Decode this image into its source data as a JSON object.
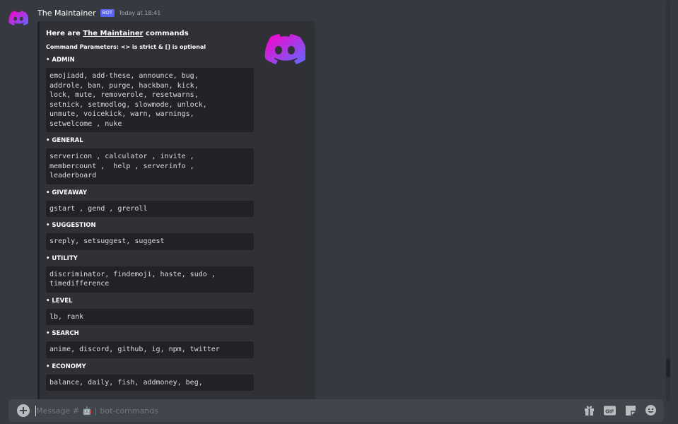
{
  "message": {
    "username": "The Maintainer",
    "bot_tag": "BOT",
    "timestamp": "Today at 18:41"
  },
  "embed": {
    "title_prefix": "Here are ",
    "title_link": "The Maintainer",
    "title_suffix": " commands",
    "description": "Command Parameters: <> is strict & [] is optional",
    "sections": [
      {
        "title": "• ADMIN",
        "commands": "emojiadd, add-these, announce, bug,\naddrole, ban, purge, hackban, kick,\nlock, mute, removerole, resetwarns,\nsetnick, setmodlog, slowmode, unlock,\nunmute, voicekick, warn, warnings,\nsetwelcome , nuke"
      },
      {
        "title": "• GENERAL",
        "commands": "servericon , calculator , invite ,\nmembercount ,  help , serverinfo ,\nleaderboard"
      },
      {
        "title": "• GIVEAWAY",
        "commands": "gstart , gend , greroll"
      },
      {
        "title": "• SUGGESTION",
        "commands": "sreply, setsuggest, suggest"
      },
      {
        "title": "• UTILITY",
        "commands": "discriminator, findemoji, haste, sudo ,\ntimedifference"
      },
      {
        "title": "• LEVEL",
        "commands": "lb, rank"
      },
      {
        "title": "• SEARCH",
        "commands": "anime, discord, github, ig, npm, twitter"
      },
      {
        "title": "• ECONOMY",
        "commands": "balance, daily, fish, addmoney, beg,"
      }
    ]
  },
  "composer": {
    "placeholder_prefix": "Message #",
    "channel_emoji": "🤖",
    "separator": "|",
    "channel_name": "bot-commands"
  },
  "colors": {
    "background": "#36393f",
    "embed_bg": "#2f3136",
    "code_bg": "#202225",
    "bot_tag": "#5865f2",
    "discord_logo_a": "#ff00c8",
    "discord_logo_b": "#5c6bff"
  },
  "icons": {
    "avatar": "discord-logo-icon",
    "thumbnail": "discord-logo-icon",
    "composer_plus": "plus-circle-icon",
    "gift": "gift-icon",
    "gif": "gif-icon",
    "sticker": "sticker-icon",
    "emoji": "emoji-icon"
  }
}
